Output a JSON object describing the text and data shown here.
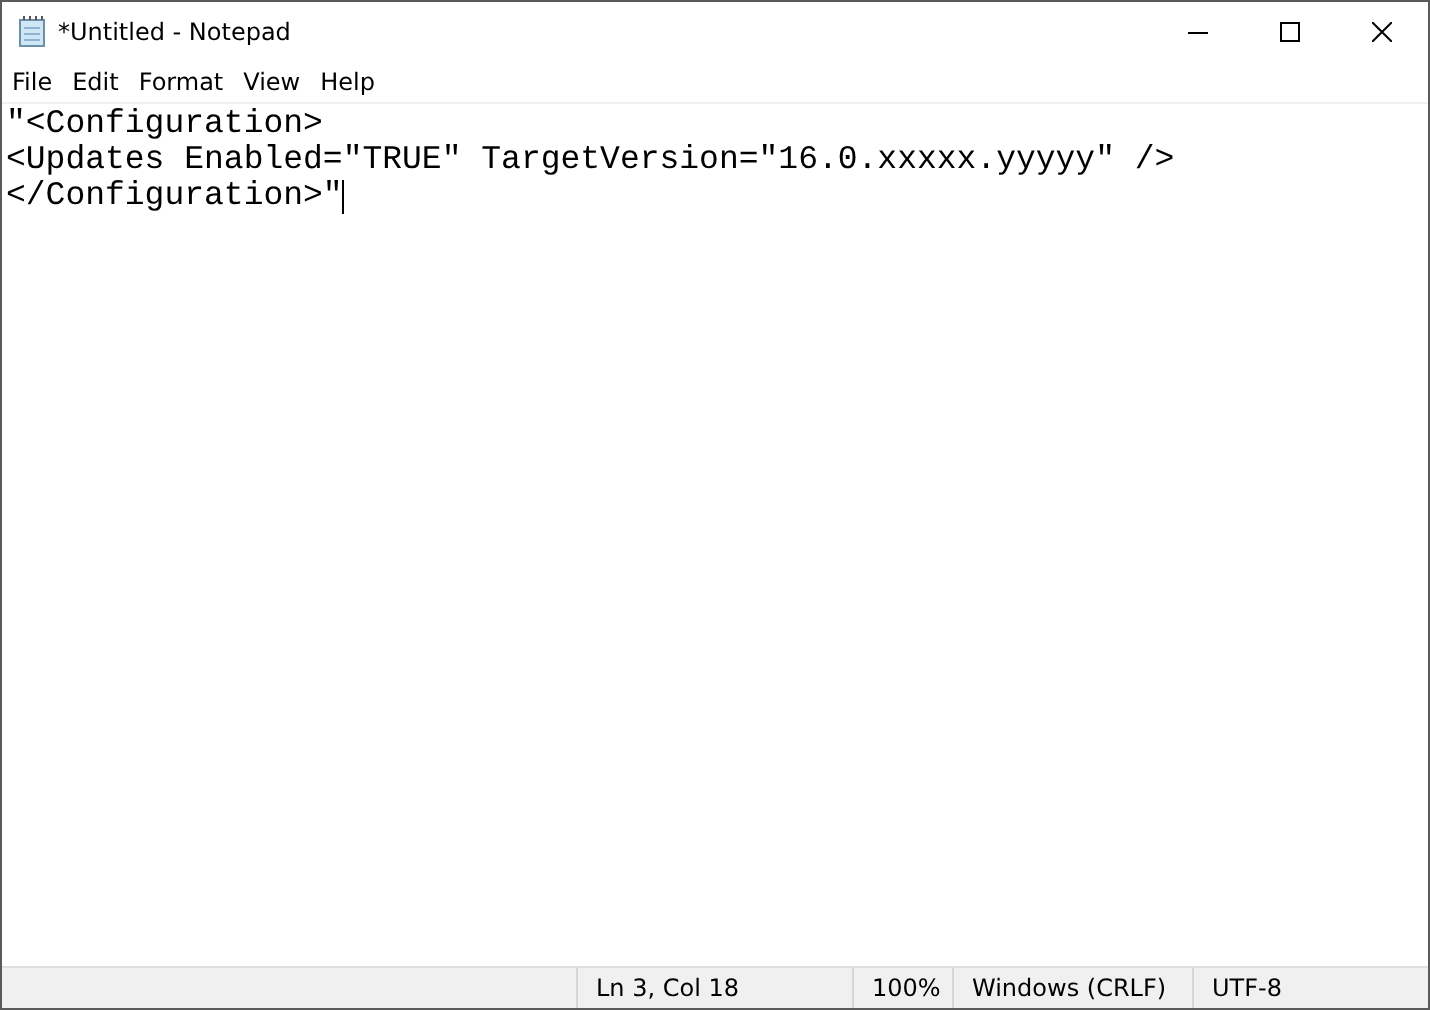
{
  "window": {
    "title": "*Untitled - Notepad"
  },
  "menu": [
    "File",
    "Edit",
    "Format",
    "View",
    "Help"
  ],
  "editor": {
    "lines": [
      "\"<Configuration>",
      "<Updates Enabled=\"TRUE\" TargetVersion=\"16.0.xxxxx.yyyyy\" />",
      "</Configuration>\""
    ]
  },
  "status_bar": {
    "position": "Ln 3, Col 18",
    "zoom": "100%",
    "line_endings": "Windows (CRLF)",
    "encoding": "UTF-8"
  }
}
